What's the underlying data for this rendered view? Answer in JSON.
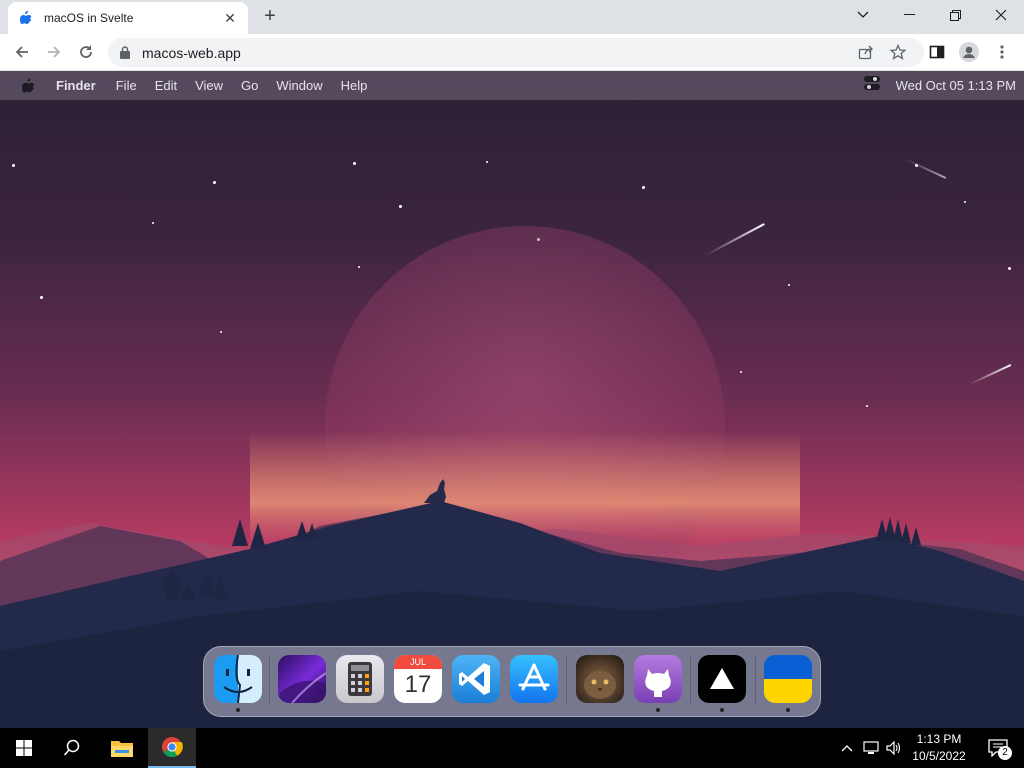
{
  "browser": {
    "tab_title": "macOS in Svelte",
    "url": "macos-web.app"
  },
  "menubar": {
    "app_name": "Finder",
    "items": [
      "File",
      "Edit",
      "View",
      "Go",
      "Window",
      "Help"
    ],
    "clock": "Wed Oct 05  1:13 PM"
  },
  "dock": {
    "apps": [
      {
        "name": "Finder",
        "icon": "finder-icon"
      },
      {
        "name": "Wallpapers",
        "icon": "wallpapers-icon"
      },
      {
        "name": "Calculator",
        "icon": "calculator-icon"
      },
      {
        "name": "Calendar",
        "icon": "calendar-icon",
        "month": "JUL",
        "day": "17"
      },
      {
        "name": "VS Code",
        "icon": "vscode-icon"
      },
      {
        "name": "App Store",
        "icon": "appstore-icon"
      },
      {
        "name": "Cat",
        "icon": "cat-icon"
      },
      {
        "name": "GitHub",
        "icon": "github-icon"
      },
      {
        "name": "Vercel",
        "icon": "vercel-icon"
      },
      {
        "name": "Ukraine",
        "icon": "ukraine-flag-icon"
      }
    ]
  },
  "taskbar": {
    "time": "1:13 PM",
    "date": "10/5/2022",
    "notifications": "2"
  },
  "colors": {
    "sky_top": "#2a2034",
    "horizon": "#e06a6a",
    "mountains": "#1f2742"
  }
}
